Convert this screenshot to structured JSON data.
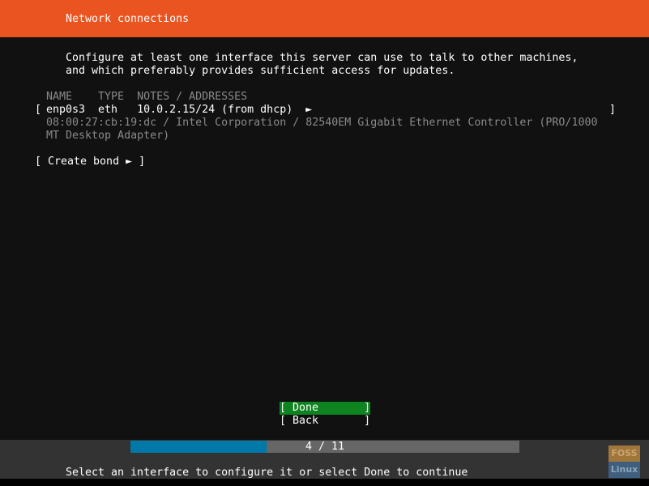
{
  "header": {
    "title": "Network connections"
  },
  "description": [
    "Configure at least one interface this server can use to talk to other machines,",
    "and which preferably provides sufficient access for updates."
  ],
  "table": {
    "columns": "NAME    TYPE  NOTES / ADDRESSES",
    "rows": [
      {
        "bracket_open": "[",
        "main": "enp0s3  eth   10.0.2.15/24 (from dhcp)  ►",
        "bracket_close": "]",
        "details": [
          "08:00:27:cb:19:dc / Intel Corporation / 82540EM Gigabit Ethernet Controller (PRO/1000",
          "MT Desktop Adapter)"
        ]
      }
    ]
  },
  "create_bond": "[ Create bond ► ]",
  "buttons": {
    "done": "[ Done       ]",
    "back": "[ Back       ]"
  },
  "progress": {
    "current": 4,
    "total": 11,
    "label": "4 / 11",
    "fraction": 0.35
  },
  "status": "Select an interface to configure it or select Done to continue",
  "watermark": {
    "line1": "FOSS",
    "line2": "Linux"
  },
  "colors": {
    "header": "#e95420",
    "done_highlight": "#0e8420",
    "progress_fill": "#0079a8"
  }
}
